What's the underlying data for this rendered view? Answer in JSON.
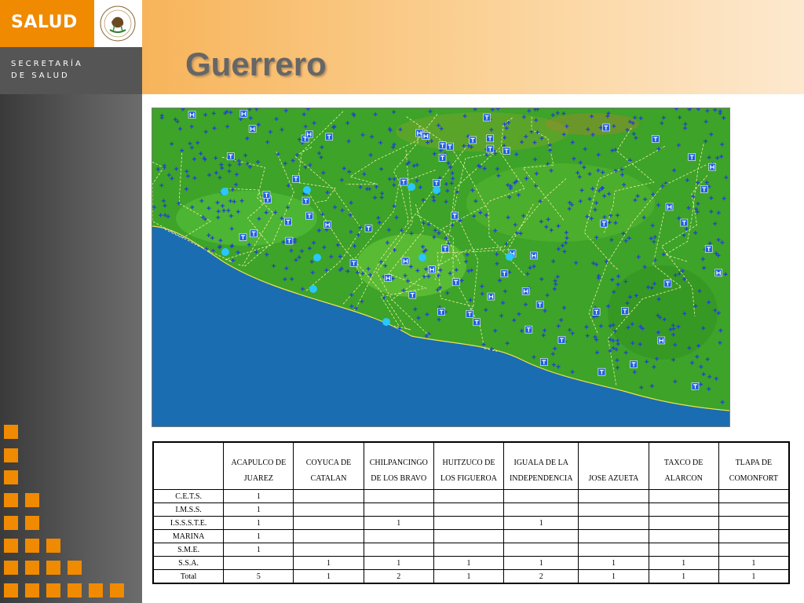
{
  "brand": {
    "salud": "SALUD",
    "secretaria_line1": "SECRETARÍA",
    "secretaria_line2": "DE SALUD",
    "accent_color": "#f08a00"
  },
  "slide": {
    "title": "Guerrero"
  },
  "map": {
    "description_icons": [
      "hospital-marker-H",
      "clinic-marker-T",
      "health-unit-cross-marker",
      "B-marker"
    ],
    "colors": {
      "land": "#3da329",
      "ocean": "#1a6db0",
      "markers": "#2a4fd0"
    }
  },
  "table": {
    "columns": [
      "",
      "ACAPULCO DE JUAREZ",
      "COYUCA DE CATALAN",
      "CHILPANCINGO DE LOS BRAVO",
      "HUITZUCO DE LOS FIGUEROA",
      "IGUALA DE LA INDEPENDENCIA",
      "JOSE AZUETA",
      "TAXCO DE ALARCON",
      "TLAPA DE COMONFORT"
    ],
    "rows": [
      {
        "label": "C.E.T.S.",
        "cells": [
          "1",
          "",
          "",
          "",
          "",
          "",
          "",
          ""
        ]
      },
      {
        "label": "I.M.S.S.",
        "cells": [
          "1",
          "",
          "",
          "",
          "",
          "",
          "",
          ""
        ]
      },
      {
        "label": "I.S.S.S.T.E.",
        "cells": [
          "1",
          "",
          "1",
          "",
          "1",
          "",
          "",
          ""
        ]
      },
      {
        "label": "MARINA",
        "cells": [
          "1",
          "",
          "",
          "",
          "",
          "",
          "",
          ""
        ]
      },
      {
        "label": "S.M.E.",
        "cells": [
          "1",
          "",
          "",
          "",
          "",
          "",
          "",
          ""
        ]
      },
      {
        "label": "S.S.A.",
        "cells": [
          "",
          "1",
          "1",
          "1",
          "1",
          "1",
          "1",
          "1"
        ]
      },
      {
        "label": "Total",
        "cells": [
          "5",
          "1",
          "2",
          "1",
          "2",
          "1",
          "1",
          "1"
        ]
      }
    ]
  }
}
